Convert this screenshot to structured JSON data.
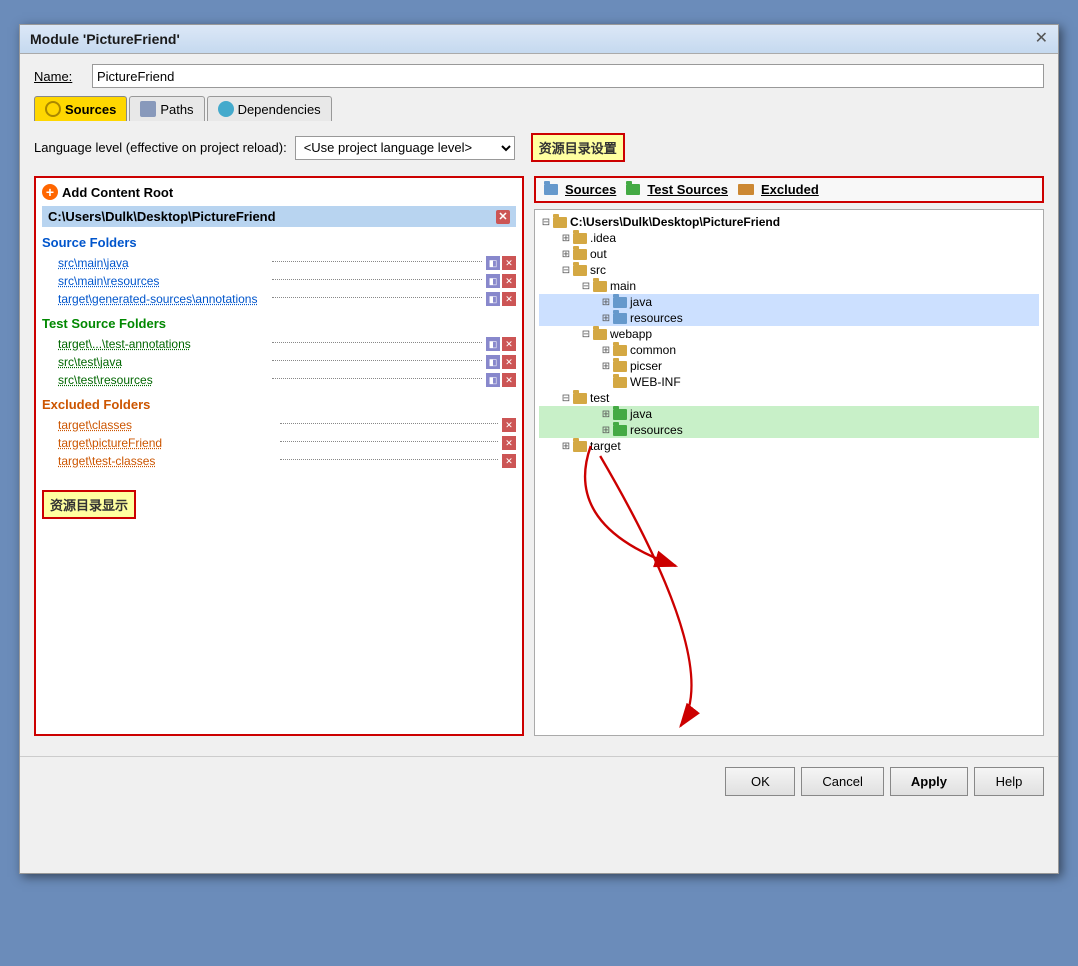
{
  "dialog": {
    "title": "Module 'PictureFriend'",
    "close_label": "✕"
  },
  "name_field": {
    "label": "Name:",
    "value": "PictureFriend"
  },
  "tabs": [
    {
      "label": "Sources",
      "active": true
    },
    {
      "label": "Paths",
      "active": false
    },
    {
      "label": "Dependencies",
      "active": false
    }
  ],
  "language_row": {
    "label": "Language level (effective on project reload):",
    "value": "<Use project language level>"
  },
  "annotation_right": "资源目录设置",
  "left_panel": {
    "add_button": "Add Content Root",
    "root_path": "C:\\Users\\Dulk\\Desktop\\PictureFriend",
    "source_section": {
      "title": "Source Folders",
      "items": [
        "src\\main\\java",
        "src\\main\\resources",
        "target\\generated-sources\\annotations"
      ]
    },
    "test_section": {
      "title": "Test Source Folders",
      "items": [
        "target\\...\\test-annotations",
        "src\\test\\java",
        "src\\test\\resources"
      ]
    },
    "excluded_section": {
      "title": "Excluded Folders",
      "items": [
        "target\\classes",
        "target\\pictureFriend",
        "target\\test-classes"
      ]
    }
  },
  "annotation_left": "资源目录显示",
  "source_tabs": [
    {
      "label": "Sources",
      "color": "blue"
    },
    {
      "label": "Test Sources",
      "color": "green"
    },
    {
      "label": "Excluded",
      "color": "orange"
    }
  ],
  "tree": {
    "root": "C:\\Users\\Dulk\\Desktop\\PictureFriend",
    "nodes": [
      {
        "label": ".idea",
        "indent": 1,
        "expanded": true,
        "type": "plain"
      },
      {
        "label": "out",
        "indent": 1,
        "expanded": true,
        "type": "plain"
      },
      {
        "label": "src",
        "indent": 1,
        "expanded": true,
        "type": "plain"
      },
      {
        "label": "main",
        "indent": 2,
        "expanded": true,
        "type": "plain"
      },
      {
        "label": "java",
        "indent": 3,
        "expanded": true,
        "type": "blue",
        "highlighted": true
      },
      {
        "label": "resources",
        "indent": 3,
        "expanded": true,
        "type": "blue",
        "highlighted": true
      },
      {
        "label": "webapp",
        "indent": 2,
        "expanded": true,
        "type": "plain"
      },
      {
        "label": "common",
        "indent": 3,
        "expanded": false,
        "type": "plain"
      },
      {
        "label": "picser",
        "indent": 3,
        "expanded": false,
        "type": "plain"
      },
      {
        "label": "WEB-INF",
        "indent": 3,
        "expanded": false,
        "type": "plain"
      },
      {
        "label": "test",
        "indent": 1,
        "expanded": true,
        "type": "plain"
      },
      {
        "label": "java",
        "indent": 3,
        "expanded": true,
        "type": "green",
        "highlighted": true
      },
      {
        "label": "resources",
        "indent": 3,
        "expanded": true,
        "type": "green",
        "highlighted": true
      },
      {
        "label": "target",
        "indent": 1,
        "expanded": true,
        "type": "plain"
      }
    ]
  },
  "footer": {
    "ok": "OK",
    "cancel": "Cancel",
    "apply": "Apply",
    "help": "Help"
  }
}
